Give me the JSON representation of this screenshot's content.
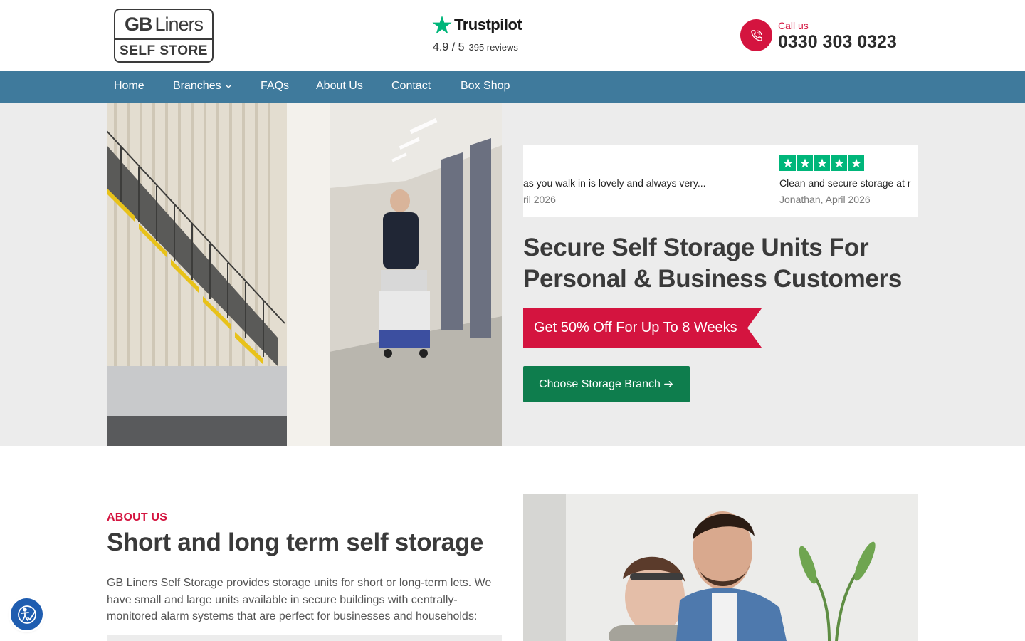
{
  "header": {
    "logo": {
      "line1_bold": "GB",
      "line1_regular": "Liners",
      "line2": "SELF STORE"
    },
    "trustpilot": {
      "name": "Trustpilot",
      "score": "4.9 / 5",
      "reviews": "395 reviews"
    },
    "call": {
      "label": "Call us",
      "number": "0330 303 0323"
    }
  },
  "nav": {
    "items": [
      {
        "label": "Home"
      },
      {
        "label": "Branches"
      },
      {
        "label": "FAQs"
      },
      {
        "label": "About Us"
      },
      {
        "label": "Contact"
      },
      {
        "label": "Box Shop"
      }
    ]
  },
  "hero": {
    "reviews": [
      {
        "text": "as you walk in is lovely and always very...",
        "meta": "ril 2026"
      },
      {
        "text": "Clean and secure storage at r",
        "meta": "Jonathan, April 2026",
        "stars": 5
      }
    ],
    "title_line1": "Secure Self Storage Units For",
    "title_line2": "Personal & Business Customers",
    "offer": "Get 50% Off For Up To 8 Weeks",
    "cta": "Choose Storage Branch"
  },
  "about": {
    "eyebrow": "ABOUT US",
    "title": "Short and long term self storage",
    "body": "GB Liners Self Storage provides storage units for short or long-term lets. We have small and large units available in secure buildings with centrally-monitored alarm systems that are perfect for businesses and households:"
  },
  "colors": {
    "brand_red": "#d4143f",
    "nav_blue": "#3f7a9c",
    "cta_green": "#0e7d4d",
    "trustpilot_green": "#00b67a",
    "hero_bg": "#ececec"
  },
  "icons": {
    "trustpilot": "trustpilot-star-icon",
    "call": "phone-icon",
    "branches": "chevron-down-icon",
    "cta": "arrow-right-icon",
    "accessibility": "accessibility-icon"
  }
}
